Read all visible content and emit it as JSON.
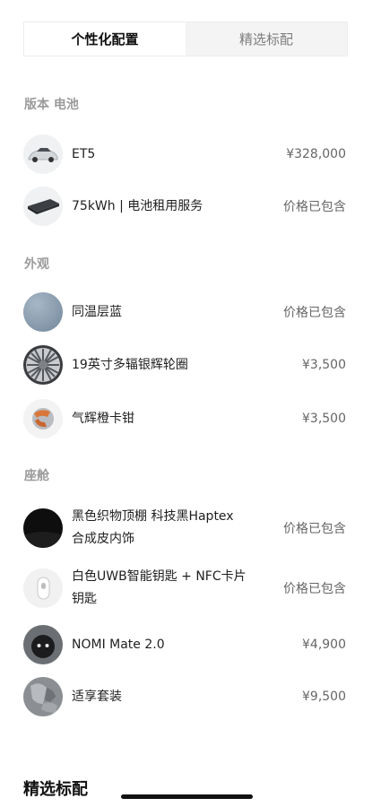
{
  "tabs": [
    {
      "label": "个性化配置",
      "active": true
    },
    {
      "label": "精选标配",
      "active": false
    }
  ],
  "sections": {
    "version": "版本 电池",
    "exterior": "外观",
    "cabin": "座舱"
  },
  "items": {
    "car": {
      "label": "ET5",
      "price": "¥328,000",
      "icon": "car-thumbnail-icon"
    },
    "battery": {
      "label": "75kWh | 电池租用服务",
      "price": "价格已包含",
      "icon": "battery-pack-icon"
    },
    "paint": {
      "label": "同温层蓝",
      "price": "价格已包含",
      "icon": "paint-color-swatch-icon",
      "color": "#8da0b2"
    },
    "wheels": {
      "label": "19英寸多辐银辉轮圈",
      "price": "¥3,500",
      "icon": "wheel-rim-icon"
    },
    "calipers": {
      "label": "气辉橙卡钳",
      "price": "¥3,500",
      "icon": "brake-caliper-icon",
      "color": "#d9773b"
    },
    "interior": {
      "label_line1": "黑色织物顶棚 科技黑Haptex",
      "label_line2": "合成皮内饰",
      "price": "价格已包含",
      "icon": "interior-swatch-icon",
      "color": "#111111"
    },
    "key": {
      "label_line1": "白色UWB智能钥匙 + NFC卡片",
      "label_line2": "钥匙",
      "price": "价格已包含",
      "icon": "smart-key-icon"
    },
    "nomi": {
      "label": "NOMI Mate 2.0",
      "price": "¥4,900",
      "icon": "nomi-robot-icon"
    },
    "seats": {
      "label": "适享套装",
      "price": "¥9,500",
      "icon": "seat-package-icon"
    }
  },
  "bottom_title": "精选标配"
}
